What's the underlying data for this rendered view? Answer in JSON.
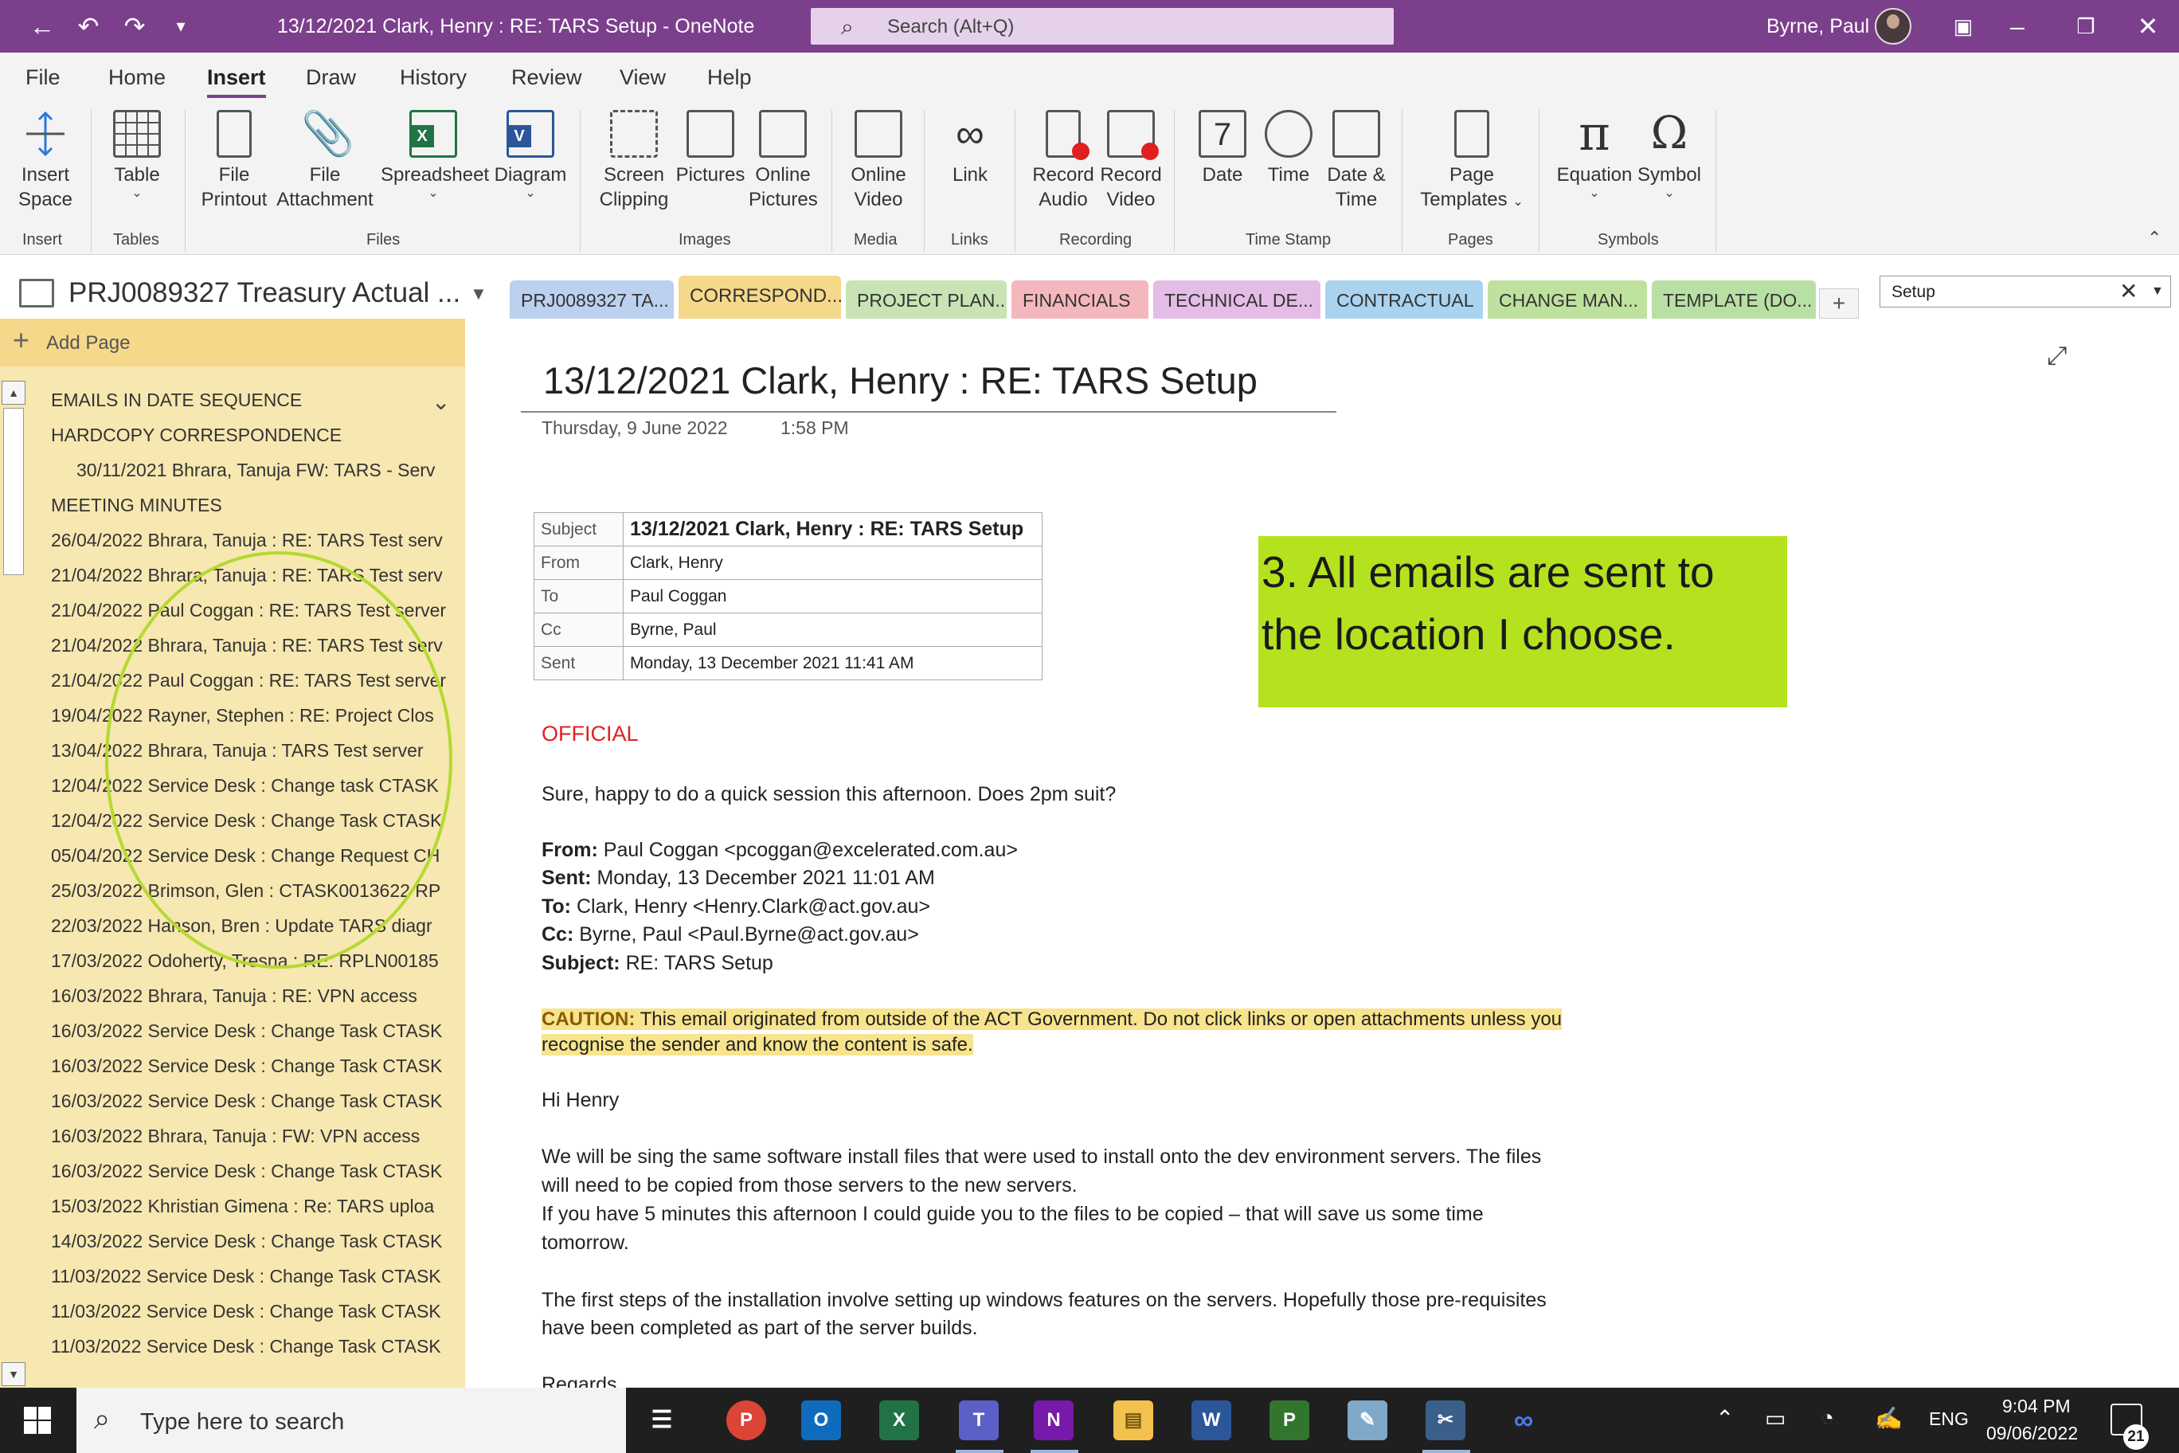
{
  "titlebar": {
    "title": "13/12/2021 Clark, Henry : RE: TARS Setup  -  OneNote",
    "search_placeholder": "Search (Alt+Q)",
    "user": "Byrne, Paul",
    "background": "#7B3F8C"
  },
  "menu": {
    "tabs": [
      "File",
      "Home",
      "Insert",
      "Draw",
      "History",
      "Review",
      "View",
      "Help"
    ],
    "active": "Insert"
  },
  "ribbon": {
    "buttons": {
      "insert_space": [
        "Insert",
        "Space"
      ],
      "table": [
        "Table",
        ""
      ],
      "file_printout": [
        "File",
        "Printout"
      ],
      "file_attachment": [
        "File",
        "Attachment"
      ],
      "spreadsheet": [
        "Spreadsheet",
        ""
      ],
      "diagram": [
        "Diagram",
        ""
      ],
      "screen_clipping": [
        "Screen",
        "Clipping"
      ],
      "pictures": [
        "Pictures",
        ""
      ],
      "online_pictures": [
        "Online",
        "Pictures"
      ],
      "online_video": [
        "Online",
        "Video"
      ],
      "link": [
        "Link",
        ""
      ],
      "record_audio": [
        "Record",
        "Audio"
      ],
      "record_video": [
        "Record",
        "Video"
      ],
      "date": [
        "Date",
        ""
      ],
      "time": [
        "Time",
        ""
      ],
      "date_time": [
        "Date &",
        "Time"
      ],
      "page_templates": [
        "Page",
        "Templates"
      ],
      "equation": [
        "Equation",
        ""
      ],
      "symbol": [
        "Symbol",
        ""
      ]
    },
    "groups": {
      "insert": "Insert",
      "tables": "Tables",
      "files": "Files",
      "images": "Images",
      "media": "Media",
      "links": "Links",
      "recording": "Recording",
      "time_stamp": "Time Stamp",
      "pages": "Pages",
      "symbols": "Symbols"
    }
  },
  "notebook": {
    "name": "PRJ0089327 Treasury Actual ..."
  },
  "sections": [
    {
      "label": "PRJ0089327 TA...",
      "color": "#bcd0f0"
    },
    {
      "label": "CORRESPOND...",
      "color": "#f6d88a"
    },
    {
      "label": "PROJECT PLAN...",
      "color": "#c8e4b4"
    },
    {
      "label": "FINANCIALS",
      "color": "#f4b7bd"
    },
    {
      "label": "TECHNICAL DE...",
      "color": "#e4bde6"
    },
    {
      "label": "CONTRACTUAL",
      "color": "#a9d3ee"
    },
    {
      "label": "CHANGE MAN...",
      "color": "#bfe19e"
    },
    {
      "label": "TEMPLATE (DO...",
      "color": "#b9e0a4"
    }
  ],
  "find_box": {
    "value": "Setup"
  },
  "pagelist": {
    "add_page": "Add Page",
    "pages": [
      "EMAILS IN DATE SEQUENCE",
      "HARDCOPY CORRESPONDENCE",
      "30/11/2021 Bhrara, Tanuja FW: TARS - Serv",
      "MEETING MINUTES",
      "26/04/2022 Bhrara, Tanuja : RE: TARS Test serv",
      "21/04/2022 Bhrara, Tanuja : RE: TARS Test serv",
      "21/04/2022 Paul Coggan : RE: TARS Test server",
      "21/04/2022 Bhrara, Tanuja : RE: TARS Test serv",
      "21/04/2022 Paul Coggan : RE: TARS Test server",
      "19/04/2022 Rayner, Stephen : RE: Project Clos",
      "13/04/2022 Bhrara, Tanuja : TARS Test server",
      "12/04/2022 Service Desk : Change task CTASK",
      "12/04/2022 Service Desk : Change Task CTASK",
      "05/04/2022 Service Desk : Change Request CH",
      "25/03/2022 Brimson, Glen : CTASK0013622 RP",
      "22/03/2022 Hanson, Bren : Update TARS diagr",
      "17/03/2022 Odoherty, Tresna : RE: RPLN00185",
      "16/03/2022 Bhrara, Tanuja : RE: VPN access",
      "16/03/2022 Service Desk : Change Task CTASK",
      "16/03/2022 Service Desk : Change Task CTASK",
      "16/03/2022 Service Desk : Change Task CTASK",
      "16/03/2022 Bhrara, Tanuja : FW: VPN access",
      "16/03/2022 Service Desk : Change Task CTASK",
      "15/03/2022 Khristian Gimena : Re: TARS uploa",
      "14/03/2022 Service Desk : Change Task CTASK",
      "11/03/2022 Service Desk : Change Task CTASK",
      "11/03/2022 Service Desk : Change Task CTASK",
      "11/03/2022 Service Desk : Change Task CTASK"
    ]
  },
  "page": {
    "title": "13/12/2021 Clark, Henry : RE: TARS Setup",
    "date": "Thursday, 9 June 2022",
    "time": "1:58 PM",
    "email_table": [
      {
        "key": "Subject",
        "value": "13/12/2021 Clark, Henry : RE: TARS Setup"
      },
      {
        "key": "From",
        "value": "Clark, Henry"
      },
      {
        "key": "To",
        "value": "Paul Coggan"
      },
      {
        "key": "Cc",
        "value": "Byrne, Paul"
      },
      {
        "key": "Sent",
        "value": "Monday, 13 December 2021 11:41 AM"
      }
    ],
    "callout": "3. All emails are sent to the location I choose.",
    "official": "OFFICIAL",
    "reply": "Sure, happy to do a quick session this afternoon. Does 2pm suit?",
    "header": {
      "from_label": "From:",
      "from": " Paul Coggan <pcoggan@excelerated.com.au>",
      "sent_label": "Sent:",
      "sent": " Monday, 13 December 2021 11:01 AM",
      "to_label": "To:",
      "to": " Clark, Henry <Henry.Clark@act.gov.au>",
      "cc_label": "Cc:",
      "cc": " Byrne, Paul <Paul.Byrne@act.gov.au>",
      "subject_label": "Subject:",
      "subject": " RE: TARS Setup"
    },
    "caution_label": "CAUTION:",
    "caution_text": " This email originated from outside of the ACT Government. Do not click links or open attachments unless you recognise the sender and know the content is safe.",
    "greeting": "Hi Henry",
    "para1_l1": "We will be sing the same software install files that were used to install onto the dev environment servers. The files",
    "para1_l2": "will need to be copied from those servers to the new servers.",
    "para1_l3": "If you have 5 minutes this afternoon I could guide you to the files to be copied – that will save us some time",
    "para1_l4": "tomorrow.",
    "para2_l1": "The first steps of the installation involve setting up windows features on the servers. Hopefully those pre-requisites",
    "para2_l2": "have been completed as part of the server builds.",
    "regards": "Regards"
  },
  "taskbar": {
    "search_placeholder": "Type here to search",
    "language": "ENG",
    "time": "9:04 PM",
    "date": "09/06/2022",
    "notifications": "21"
  }
}
